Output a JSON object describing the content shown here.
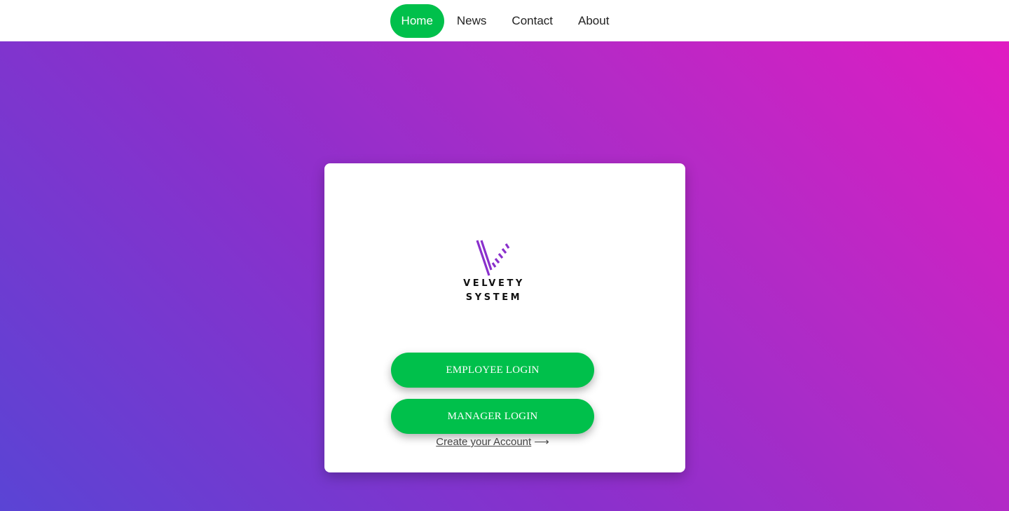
{
  "nav": {
    "items": [
      {
        "label": "Home",
        "active": true
      },
      {
        "label": "News",
        "active": false
      },
      {
        "label": "Contact",
        "active": false
      },
      {
        "label": "About",
        "active": false
      }
    ]
  },
  "colors": {
    "accent": "#00c04b",
    "gradient_start": "#5a44d4",
    "gradient_end": "#e01cc2",
    "logo_purple": "#8a30cc"
  },
  "logo": {
    "icon": "velvety-v-logo-icon",
    "line1": "VELVETY",
    "line2": "SYSTEM"
  },
  "card": {
    "employee_login_label": "EMPLOYEE LOGIN",
    "manager_login_label": "MANAGER LOGIN",
    "create_account_label": "Create your Account",
    "arrow_icon": "long-right-arrow-icon",
    "arrow_glyph": "⟶"
  }
}
